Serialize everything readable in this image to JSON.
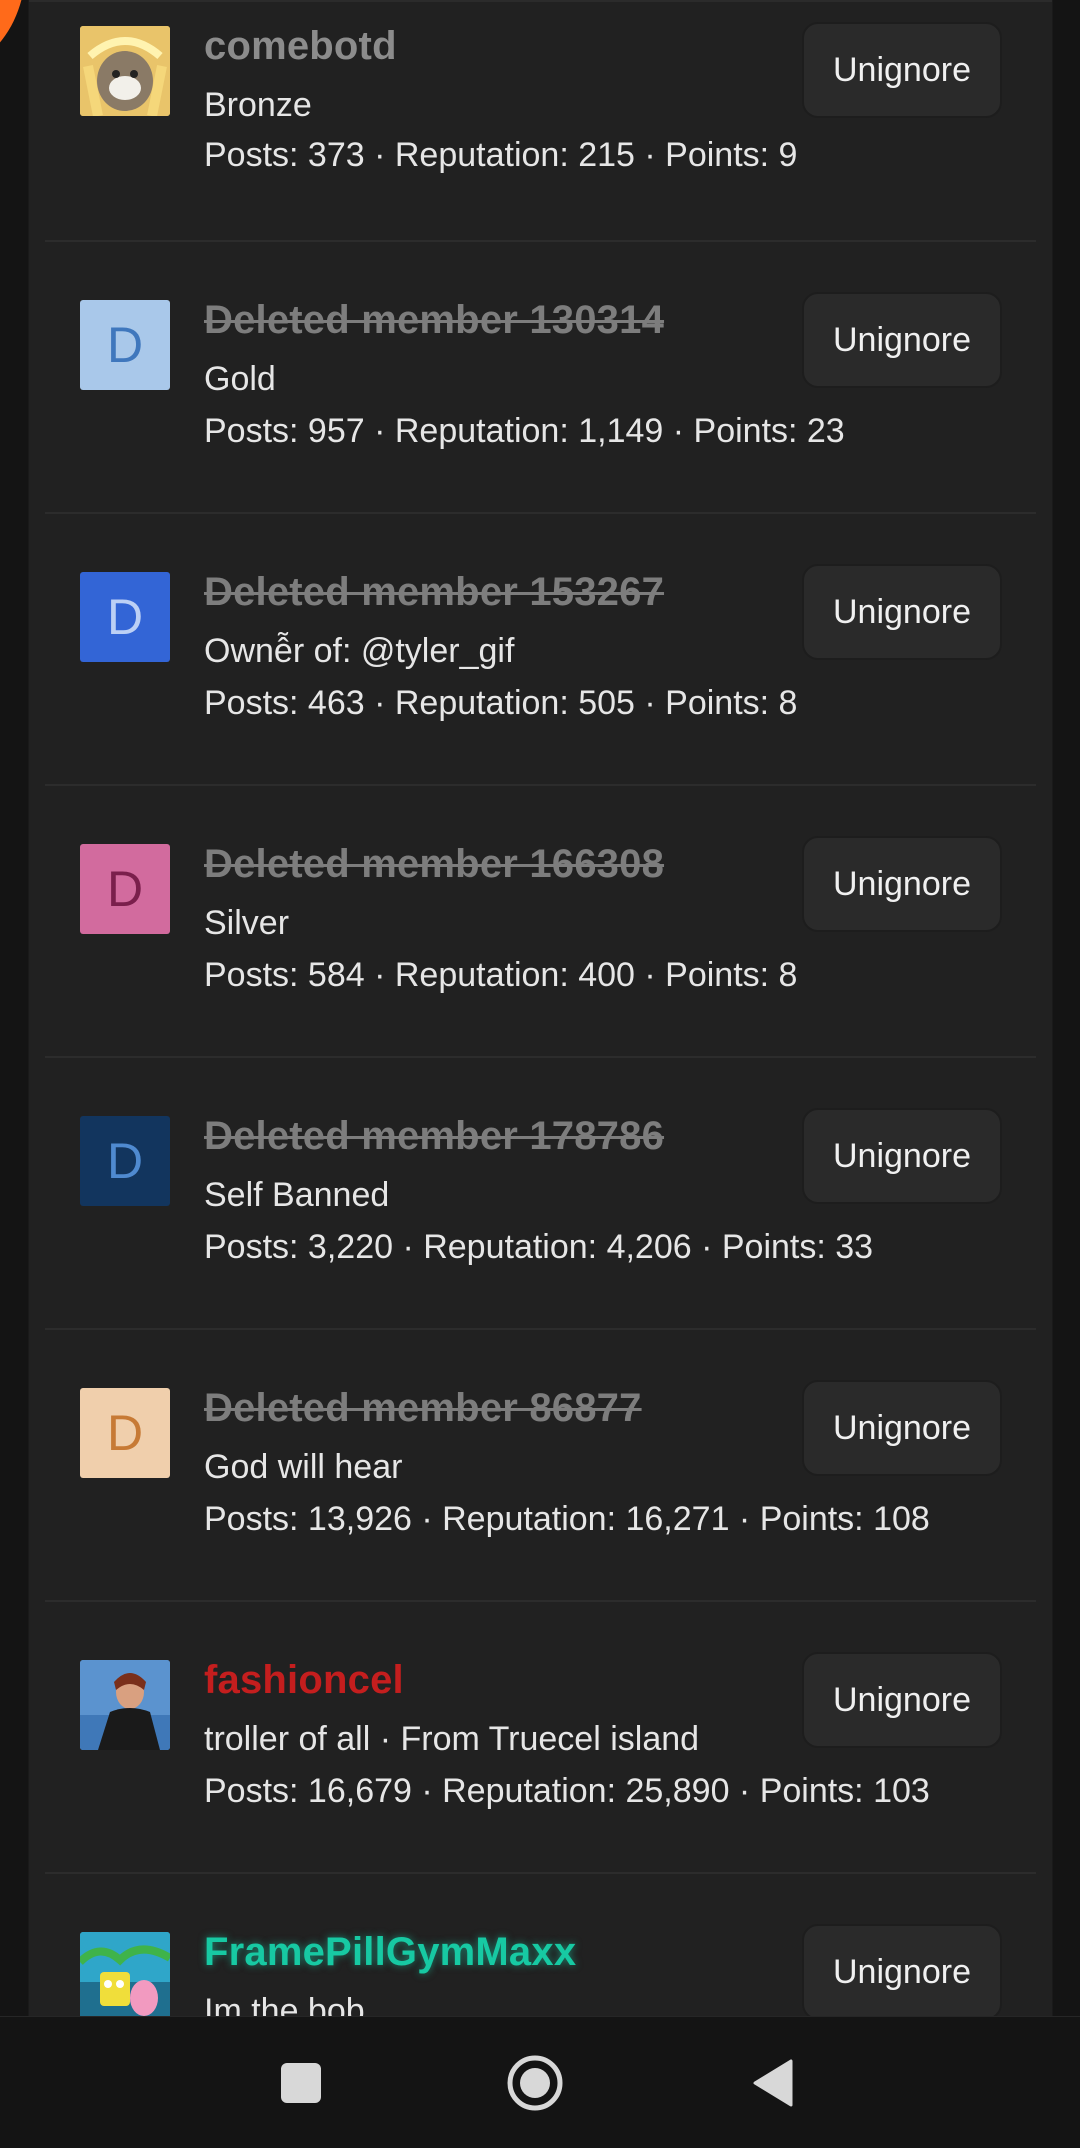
{
  "members": [
    {
      "name": "comebotd",
      "subtitle": "Bronze",
      "stats": "Posts: 373 · Reputation: 215 · Points: 9",
      "avatar_letter": "",
      "avatar_bg": "#d9b44a",
      "avatar_fg": "#ffffff",
      "style": "normal",
      "button": "Unignore"
    },
    {
      "name": "Deleted member 130314",
      "subtitle": "Gold",
      "stats": "Posts: 957 · Reputation: 1,149 · Points: 23",
      "avatar_letter": "D",
      "avatar_bg": "#a9c8ea",
      "avatar_fg": "#3f77bd",
      "style": "deleted",
      "button": "Unignore"
    },
    {
      "name": "Deleted member 153267",
      "subtitle": "Ownễr of: @tyler_gif",
      "stats": "Posts: 463 · Reputation: 505 · Points: 8",
      "avatar_letter": "D",
      "avatar_bg": "#3365d6",
      "avatar_fg": "#bcd0f5",
      "style": "deleted",
      "button": "Unignore"
    },
    {
      "name": "Deleted member 166308",
      "subtitle": "Silver",
      "stats": "Posts: 584 · Reputation: 400 · Points: 8",
      "avatar_letter": "D",
      "avatar_bg": "#d26b9e",
      "avatar_fg": "#7a1f4c",
      "style": "deleted",
      "button": "Unignore"
    },
    {
      "name": "Deleted member 178786",
      "subtitle": "Self Banned",
      "stats": "Posts: 3,220 · Reputation: 4,206 · Points: 33",
      "avatar_letter": "D",
      "avatar_bg": "#12355e",
      "avatar_fg": "#4f8ad0",
      "style": "deleted",
      "button": "Unignore"
    },
    {
      "name": "Deleted member 86877",
      "subtitle": "God will hear",
      "stats": "Posts: 13,926 · Reputation: 16,271 · Points: 108",
      "avatar_letter": "D",
      "avatar_bg": "#f0cfac",
      "avatar_fg": "#c77a35",
      "style": "deleted",
      "button": "Unignore"
    },
    {
      "name": "fashioncel",
      "subtitle": "troller of all · From Truecel island",
      "stats": "Posts: 16,679 · Reputation: 25,890 · Points: 103",
      "avatar_letter": "",
      "avatar_bg": "#4a86c7",
      "avatar_fg": "#ffffff",
      "style": "red",
      "button": "Unignore"
    },
    {
      "name": "FramePillGymMaxx",
      "subtitle": "Im the bob",
      "stats": "",
      "avatar_letter": "",
      "avatar_bg": "#2f9ac0",
      "avatar_fg": "#ffffff",
      "style": "teal",
      "button": "Unignore"
    }
  ],
  "navbar": {
    "icons": [
      "square-icon",
      "circle-icon",
      "back-triangle-icon"
    ]
  },
  "colors": {
    "background": "#141414",
    "panel": "#212121",
    "button": "#2a2a2a",
    "deleted_name": "#7d7d7d",
    "red_name": "#c41e1e",
    "teal_name": "#17c9a3"
  }
}
